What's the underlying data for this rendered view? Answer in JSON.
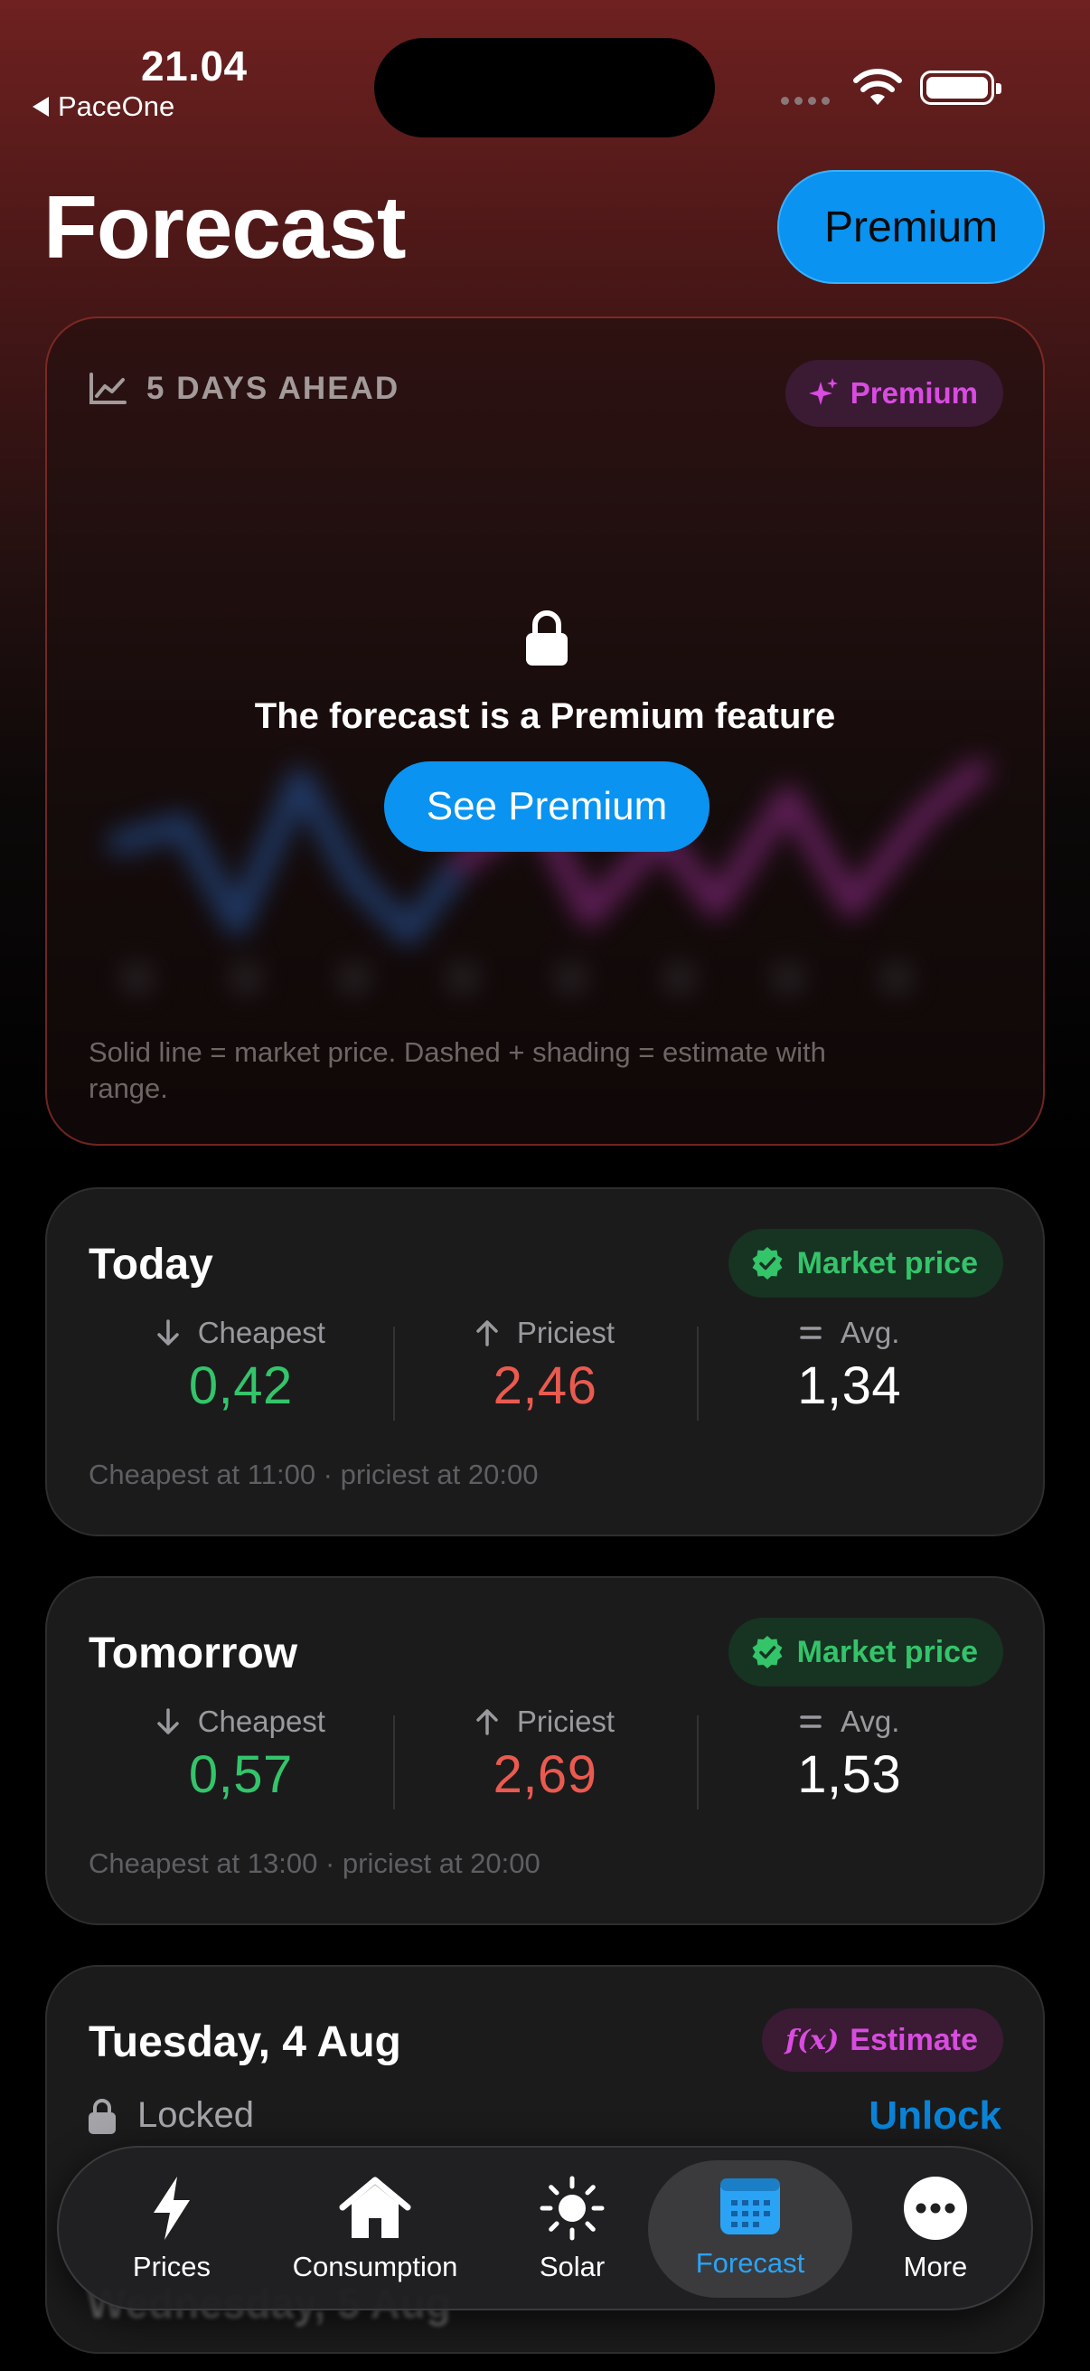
{
  "status_bar": {
    "time": "21.04",
    "back_app": "PaceOne"
  },
  "header": {
    "title": "Forecast",
    "premium_button": "Premium"
  },
  "forecast_card": {
    "heading": "5 DAYS AHEAD",
    "badge": "Premium",
    "locked_message": "The forecast is a Premium feature",
    "cta": "See Premium",
    "footnote": "Solid line = market price. Dashed + shading = estimate with range.",
    "icons": {
      "heading": "chart-line-icon",
      "badge": "sparkles-icon",
      "lock": "lock-icon"
    }
  },
  "days": [
    {
      "title": "Today",
      "badge": "Market price",
      "stats": [
        {
          "label": "Cheapest",
          "icon": "arrow-down-icon",
          "value": "0,42",
          "color": "#34c46a"
        },
        {
          "label": "Priciest",
          "icon": "arrow-up-icon",
          "value": "2,46",
          "color": "#ea5a4f"
        },
        {
          "label": "Avg.",
          "icon": "equals-icon",
          "value": "1,34",
          "color": "#ffffff"
        }
      ],
      "footnote": "Cheapest at 11:00 · priciest at 20:00"
    },
    {
      "title": "Tomorrow",
      "badge": "Market price",
      "stats": [
        {
          "label": "Cheapest",
          "icon": "arrow-down-icon",
          "value": "0,57",
          "color": "#34c46a"
        },
        {
          "label": "Priciest",
          "icon": "arrow-up-icon",
          "value": "2,69",
          "color": "#ea5a4f"
        },
        {
          "label": "Avg.",
          "icon": "equals-icon",
          "value": "1,53",
          "color": "#ffffff"
        }
      ],
      "footnote": "Cheapest at 13:00 · priciest at 20:00"
    }
  ],
  "locked_day": {
    "title": "Tuesday, 4 Aug",
    "badge_fx": "f(x)",
    "badge": "Estimate",
    "locked_label": "Locked",
    "unlock": "Unlock"
  },
  "next_day_partial": "Wednesday, 5 Aug",
  "tabs": [
    {
      "label": "Prices",
      "icon": "bolt-icon",
      "active": false
    },
    {
      "label": "Consumption",
      "icon": "house-icon",
      "active": false
    },
    {
      "label": "Solar",
      "icon": "sun-icon",
      "active": false
    },
    {
      "label": "Forecast",
      "icon": "calendar-icon",
      "active": true
    },
    {
      "label": "More",
      "icon": "ellipsis-circle-icon",
      "active": false
    }
  ],
  "colors": {
    "accent": "#0a93f0",
    "premium_magenta": "#d84ce0",
    "market_green": "#34c46a",
    "price_red": "#ea5a4f"
  }
}
